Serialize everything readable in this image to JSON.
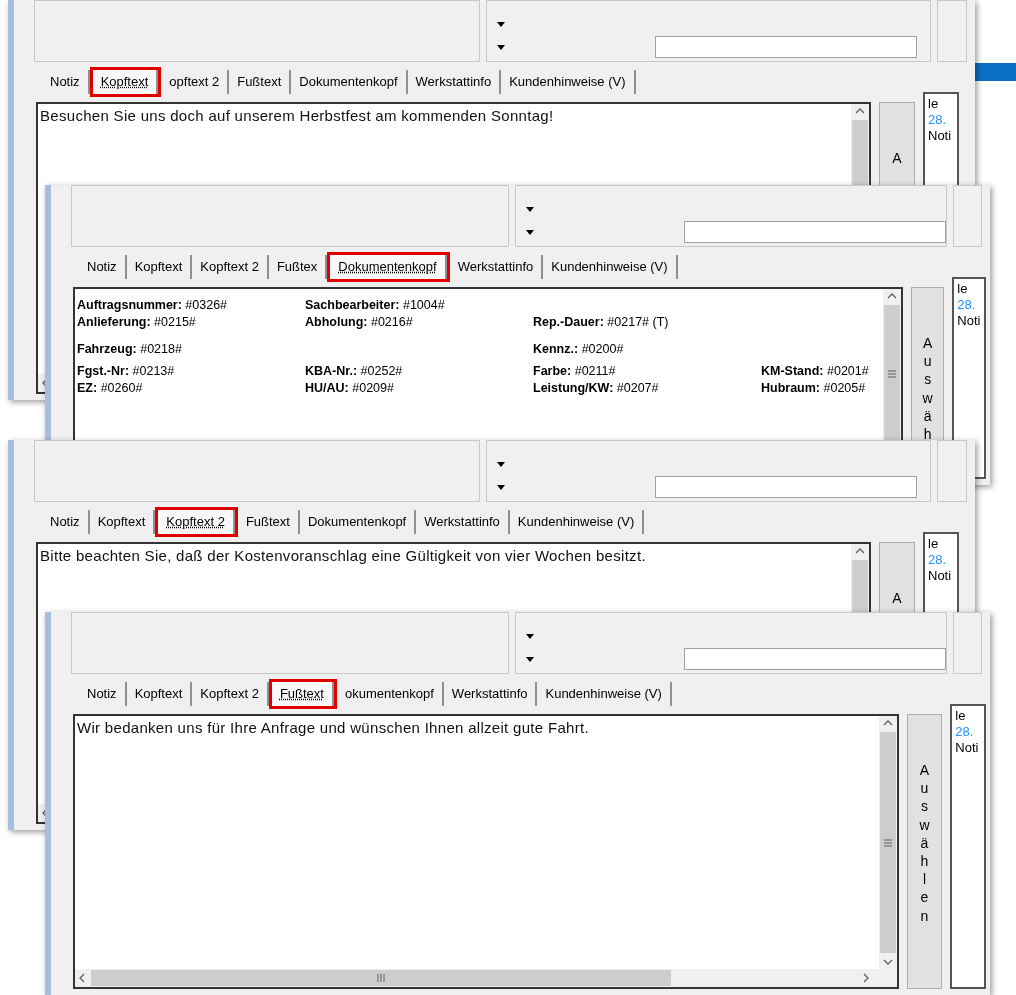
{
  "windows": [
    {
      "tabs": [
        {
          "label": "Notiz",
          "selected": false
        },
        {
          "label": "Kopftext",
          "selected": true
        },
        {
          "label": "opftext 2",
          "selected": false
        },
        {
          "label": "Fußtext",
          "selected": false
        },
        {
          "label": "Dokumentenkopf",
          "selected": false
        },
        {
          "label": "Werkstattinfo",
          "selected": false
        },
        {
          "label": "Kundenhinweise (V)",
          "selected": false
        }
      ],
      "content": {
        "kind": "text",
        "text": "Besuchen Sie uns doch auf unserem Herbstfest am kommenden Sonntag!"
      },
      "button_text": "A",
      "side_panel": [
        {
          "text": "le",
          "kind": "plain"
        },
        {
          "text": "28.",
          "kind": "link"
        },
        {
          "text": "Noti",
          "kind": "plain"
        }
      ]
    },
    {
      "tabs": [
        {
          "label": "Notiz",
          "selected": false
        },
        {
          "label": "Kopftext",
          "selected": false
        },
        {
          "label": "Kopftext 2",
          "selected": false
        },
        {
          "label": "Fußtex",
          "selected": false
        },
        {
          "label": "Dokumentenkopf",
          "selected": true
        },
        {
          "label": "Werkstattinfo",
          "selected": false
        },
        {
          "label": "Kundenhinweise (V)",
          "selected": false
        }
      ],
      "content": {
        "kind": "fields",
        "rows": [
          [
            {
              "label": "Auftragsnummer:",
              "value": "#0326#"
            },
            {
              "label": "Sachbearbeiter:",
              "value": "#1004#"
            },
            null,
            null
          ],
          [
            {
              "label": "Anlieferung:",
              "value": "#0215#"
            },
            {
              "label": "Abholung:",
              "value": "#0216#"
            },
            {
              "label": "Rep.-Dauer:",
              "value": "#0217#",
              "note": "(T)"
            },
            null
          ],
          [
            {
              "label": "Fahrzeug:",
              "value": "#0218#"
            },
            null,
            {
              "label": "Kennz.:",
              "value": "#0200#"
            },
            null
          ],
          [
            {
              "label": "Fgst.-Nr:",
              "value": "#0213#"
            },
            {
              "label": "KBA-Nr.:",
              "value": "#0252#"
            },
            {
              "label": "Farbe:",
              "value": "#0211#"
            },
            {
              "label": "KM-Stand:",
              "value": "#0201#"
            }
          ],
          [
            {
              "label": "EZ:",
              "value": "#0260#"
            },
            {
              "label": "HU/AU:",
              "value": "#0209#"
            },
            {
              "label": "Leistung/KW:",
              "value": "#0207#"
            },
            {
              "label": "Hubraum:",
              "value": "#0205#"
            }
          ]
        ]
      },
      "button_text": "Auswäh",
      "side_panel": [
        {
          "text": "le",
          "kind": "plain"
        },
        {
          "text": "28.",
          "kind": "link"
        },
        {
          "text": "Noti",
          "kind": "plain"
        }
      ]
    },
    {
      "tabs": [
        {
          "label": "Notiz",
          "selected": false
        },
        {
          "label": "Kopftext",
          "selected": false
        },
        {
          "label": "Kopftext 2",
          "selected": true
        },
        {
          "label": "Fußtext",
          "selected": false
        },
        {
          "label": "Dokumentenkopf",
          "selected": false
        },
        {
          "label": "Werkstattinfo",
          "selected": false
        },
        {
          "label": "Kundenhinweise (V)",
          "selected": false
        }
      ],
      "content": {
        "kind": "text",
        "text": "Bitte beachten Sie, daß der Kostenvoranschlag eine Gültigkeit von vier Wochen besitzt."
      },
      "button_text": "A",
      "side_panel": [
        {
          "text": "le",
          "kind": "plain"
        },
        {
          "text": "28.",
          "kind": "link"
        },
        {
          "text": "Noti",
          "kind": "plain"
        }
      ]
    },
    {
      "tabs": [
        {
          "label": "Notiz",
          "selected": false
        },
        {
          "label": "Kopftext",
          "selected": false
        },
        {
          "label": "Kopftext 2",
          "selected": false
        },
        {
          "label": "Fußtext",
          "selected": true
        },
        {
          "label": "okumentenkopf",
          "selected": false
        },
        {
          "label": "Werkstattinfo",
          "selected": false
        },
        {
          "label": "Kundenhinweise (V)",
          "selected": false
        }
      ],
      "content": {
        "kind": "text",
        "text": "Wir bedanken uns für Ihre Anfrage und wünschen Ihnen allzeit gute Fahrt."
      },
      "button_text": "Auswählen",
      "side_panel": [
        {
          "text": "le",
          "kind": "plain"
        },
        {
          "text": "28.",
          "kind": "link"
        },
        {
          "text": "Noti",
          "kind": "plain"
        }
      ]
    }
  ]
}
